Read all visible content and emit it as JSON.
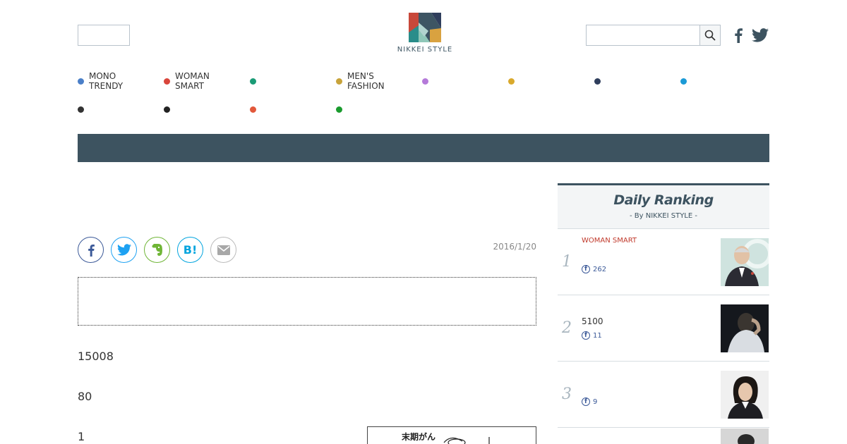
{
  "header": {
    "logo_text": "NIKKEI STYLE",
    "search_placeholder": "",
    "left_box_value": "",
    "icons": [
      "search-icon",
      "facebook-icon",
      "twitter-icon"
    ]
  },
  "categories": [
    {
      "label": "MONO\nTRENDY",
      "color": "#4a7fc8"
    },
    {
      "label": "WOMAN\nSMART",
      "color": "#d9453b"
    },
    {
      "label": "",
      "color": "#1a9b76"
    },
    {
      "label": "MEN'S\nFASHION",
      "color": "#c8a33a"
    },
    {
      "label": "",
      "color": "#b57ad9"
    },
    {
      "label": "",
      "color": "#d9a92c"
    },
    {
      "label": "",
      "color": "#2f3e5c"
    },
    {
      "label": "",
      "color": "#1b9ad6"
    },
    {
      "label": "",
      "color": "#333333"
    },
    {
      "label": "",
      "color": "#222222"
    },
    {
      "label": "",
      "color": "#e2583b"
    },
    {
      "label": "",
      "color": "#1a9b2e"
    }
  ],
  "article": {
    "date": "2016/1/20",
    "share_buttons": [
      "facebook-icon",
      "twitter-icon",
      "evernote-icon",
      "hatena-bookmark-icon",
      "mail-icon"
    ],
    "share_hatena_label": "B!",
    "paragraphs": [
      "15008",
      "80",
      "1"
    ]
  },
  "ranking": {
    "title": "Daily Ranking",
    "subtitle": "- By NIKKEI STYLE -",
    "items": [
      {
        "rank": "1",
        "category": "WOMAN SMART",
        "text": "",
        "fb_count": "262"
      },
      {
        "rank": "2",
        "category": "",
        "text": "5100",
        "fb_count": "11"
      },
      {
        "rank": "3",
        "category": "",
        "text": "",
        "fb_count": "9"
      }
    ]
  },
  "colors": {
    "banner": "#3d5360",
    "ranking_accent": "#3d5360",
    "facebook": "#3b5998",
    "twitter": "#1da1f2",
    "evernote": "#6fb536",
    "hatena": "#00a4de",
    "mail": "#999999"
  }
}
